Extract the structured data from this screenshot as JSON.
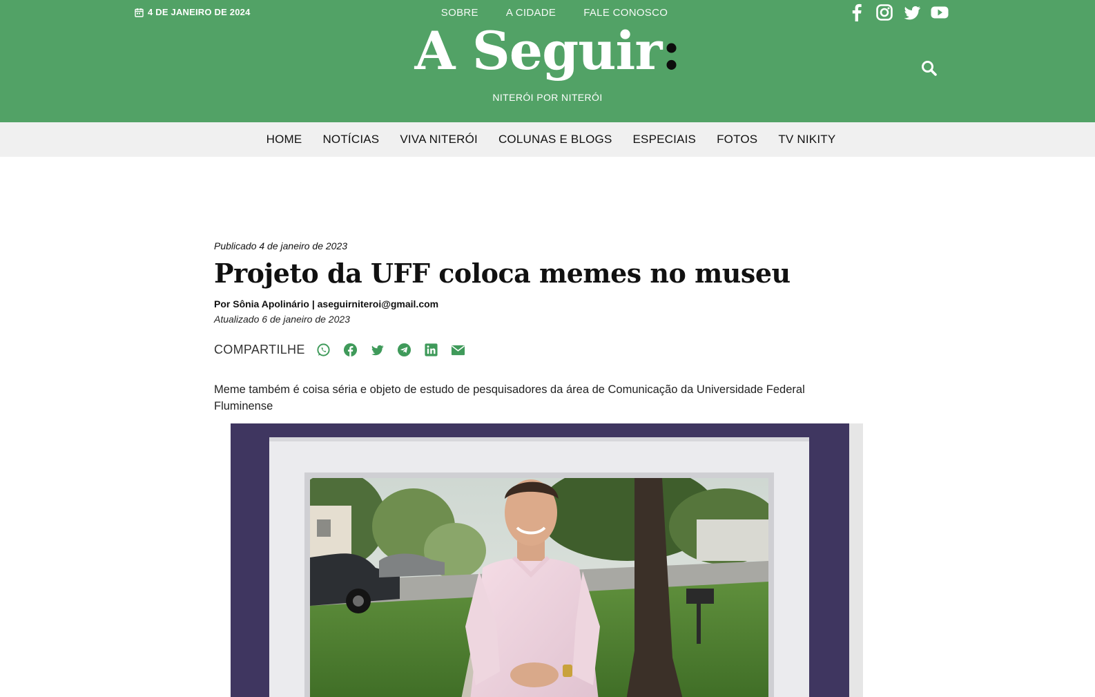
{
  "header": {
    "date": "4 DE JANEIRO DE 2024",
    "top_links": [
      "SOBRE",
      "A CIDADE",
      "FALE CONOSCO"
    ],
    "logo_text": "A Seguir",
    "logo_colon": ":",
    "tagline": "NITERÓI POR NITERÓI",
    "social_icons": [
      "facebook-icon",
      "instagram-icon",
      "twitter-icon",
      "youtube-icon"
    ],
    "brand_color": "#52a266"
  },
  "nav": {
    "items": [
      "HOME",
      "NOTÍCIAS",
      "VIVA NITERÓI",
      "COLUNAS E BLOGS",
      "ESPECIAIS",
      "FOTOS",
      "TV NIKITY"
    ]
  },
  "article": {
    "published": "Publicado 4 de janeiro de 2023",
    "title": "Projeto da UFF coloca memes no museu",
    "byline": "Por Sônia Apolinário | aseguirniteroi@gmail.com",
    "updated": "Atualizado 6 de janeiro de 2023",
    "share_label": "COMPARTILHE",
    "share_icons": [
      "whatsapp-icon",
      "facebook-icon",
      "twitter-icon",
      "telegram-icon",
      "linkedin-icon",
      "email-icon"
    ],
    "share_color": "#3f9a5a",
    "lede": "Meme também é coisa séria e objeto de estudo de pesquisadores da área de Comunicação da Universidade Federal Fluminense"
  }
}
